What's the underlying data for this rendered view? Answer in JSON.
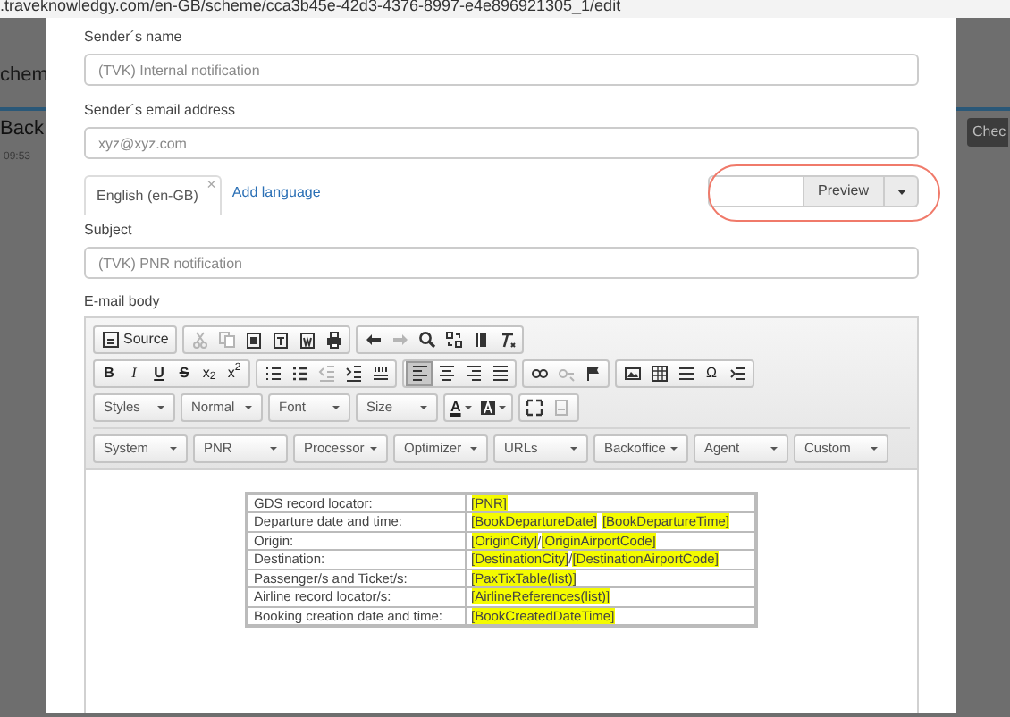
{
  "browser": {
    "url": ".traveknowledgy.com/en-GB/scheme/cca3b45e-42d3-4376-8997-e4e896921305_1/edit"
  },
  "background": {
    "heading": "chem",
    "title": "Back",
    "time": "09:53",
    "button": "Chec"
  },
  "form": {
    "sender_name": {
      "label": "Sender´s name",
      "placeholder": "(TVK) Internal notification"
    },
    "sender_email": {
      "label": "Sender´s email address",
      "placeholder": "xyz@xyz.com"
    },
    "language_tabs": [
      {
        "label": "English (en-GB)",
        "close": "×",
        "selected": true
      }
    ],
    "add_language": "Add language",
    "preview": {
      "button": "Preview",
      "highlighted": true
    },
    "subject": {
      "label": "Subject",
      "placeholder": "(TVK) PNR notification"
    },
    "body_label": "E-mail body",
    "toolbar": [
      [
        [
          {
            "kind": "icon-text",
            "text": "Source",
            "disabled": false
          }
        ],
        [
          {
            "kind": "icon",
            "disabled": true,
            "on": false
          },
          {
            "kind": "icon",
            "disabled": true,
            "on": false
          },
          {
            "kind": "icon",
            "disabled": false,
            "on": false
          },
          {
            "kind": "icon",
            "disabled": false,
            "on": false
          },
          {
            "kind": "icon",
            "disabled": false,
            "on": false
          },
          {
            "kind": "icon",
            "disabled": false,
            "on": false
          }
        ],
        [
          {
            "kind": "icon",
            "disabled": false,
            "on": false
          },
          {
            "kind": "icon",
            "disabled": true,
            "on": false
          },
          {
            "kind": "icon",
            "disabled": false,
            "on": false
          },
          {
            "kind": "icon",
            "disabled": false,
            "on": false
          },
          {
            "kind": "icon",
            "disabled": false,
            "on": false
          },
          {
            "kind": "icon",
            "disabled": false,
            "on": false
          }
        ]
      ],
      [
        [
          {
            "kind": "char",
            "text": "B"
          },
          {
            "kind": "char",
            "text": "I"
          },
          {
            "kind": "char",
            "text": "U"
          },
          {
            "kind": "char",
            "text": "S"
          },
          {
            "kind": "char",
            "text": "x$_{2}$"
          },
          {
            "kind": "char",
            "text": "x$^{2}$"
          }
        ],
        [
          {
            "kind": "icon",
            "disabled": false,
            "on": false
          },
          {
            "kind": "icon",
            "disabled": false,
            "on": false
          },
          {
            "kind": "icon",
            "disabled": true,
            "on": false
          },
          {
            "kind": "icon",
            "disabled": false,
            "on": false
          },
          {
            "kind": "icon",
            "disabled": false,
            "on": false
          }
        ],
        [
          {
            "kind": "icon",
            "disabled": false,
            "on": true
          },
          {
            "kind": "icon",
            "disabled": false,
            "on": false
          },
          {
            "kind": "icon",
            "disabled": false,
            "on": false
          },
          {
            "kind": "icon",
            "disabled": false,
            "on": false
          }
        ],
        [
          {
            "kind": "icon",
            "disabled": false,
            "on": false
          },
          {
            "kind": "icon",
            "disabled": true,
            "on": false
          },
          {
            "kind": "icon",
            "disabled": false,
            "on": false
          }
        ],
        [
          {
            "kind": "icon",
            "disabled": false,
            "on": false
          },
          {
            "kind": "icon",
            "disabled": false,
            "on": false
          },
          {
            "kind": "icon",
            "disabled": false,
            "on": false
          },
          {
            "kind": "char",
            "text": "Ω"
          },
          {
            "kind": "icon",
            "disabled": false,
            "on": false
          }
        ]
      ],
      [
        [
          {
            "kind": "combo",
            "text": "Styles"
          }
        ],
        [
          {
            "kind": "combo",
            "text": "Normal"
          }
        ],
        [
          {
            "kind": "combo",
            "text": "Font"
          }
        ],
        [
          {
            "kind": "combo",
            "text": "Size"
          }
        ],
        [
          {
            "kind": "color",
            "text": "A"
          },
          {
            "kind": "icon-caret",
            "disabled": false
          }
        ],
        [
          {
            "kind": "icon",
            "disabled": false,
            "on": false
          },
          {
            "kind": "icon",
            "disabled": true,
            "on": false
          }
        ]
      ]
    ],
    "placeholder_menus": [
      "System",
      "PNR",
      "Processor",
      "Optimizer",
      "URLs",
      "Backoffice",
      "Agent",
      "Custom"
    ],
    "content_table": [
      {
        "label": "GDS record locator:",
        "value": [
          {
            "text": "[PNR]",
            "highlight": true
          }
        ]
      },
      {
        "label": "Departure date and time:",
        "value": [
          {
            "text": "[BookDepartureDate]",
            "highlight": true
          },
          {
            "text": "[BookDepartureTime]",
            "highlight": true
          }
        ]
      },
      {
        "label": "Origin:",
        "value": [
          {
            "text": "[OriginCity]",
            "highlight": true
          },
          {
            "text": "/",
            "highlight": false
          },
          {
            "text": "[OriginAirportCode]",
            "highlight": true
          }
        ]
      },
      {
        "label": "Destination:",
        "value": [
          {
            "text": "[DestinationCity]",
            "highlight": true
          },
          {
            "text": "/",
            "highlight": false
          },
          {
            "text": "[DestinationAirportCode]",
            "highlight": true
          }
        ]
      },
      {
        "label": "Passenger/s and Ticket/s:",
        "value": [
          {
            "text": "[PaxTixTable(list)]",
            "highlight": true
          }
        ]
      },
      {
        "label": "Airline record locator/s:",
        "value": [
          {
            "text": "[AirlineReferences(list)]",
            "highlight": true
          }
        ]
      },
      {
        "label": "Booking creation date and time:",
        "value": [
          {
            "text": "[BookCreatedDateTime]",
            "highlight": true
          }
        ]
      }
    ]
  }
}
